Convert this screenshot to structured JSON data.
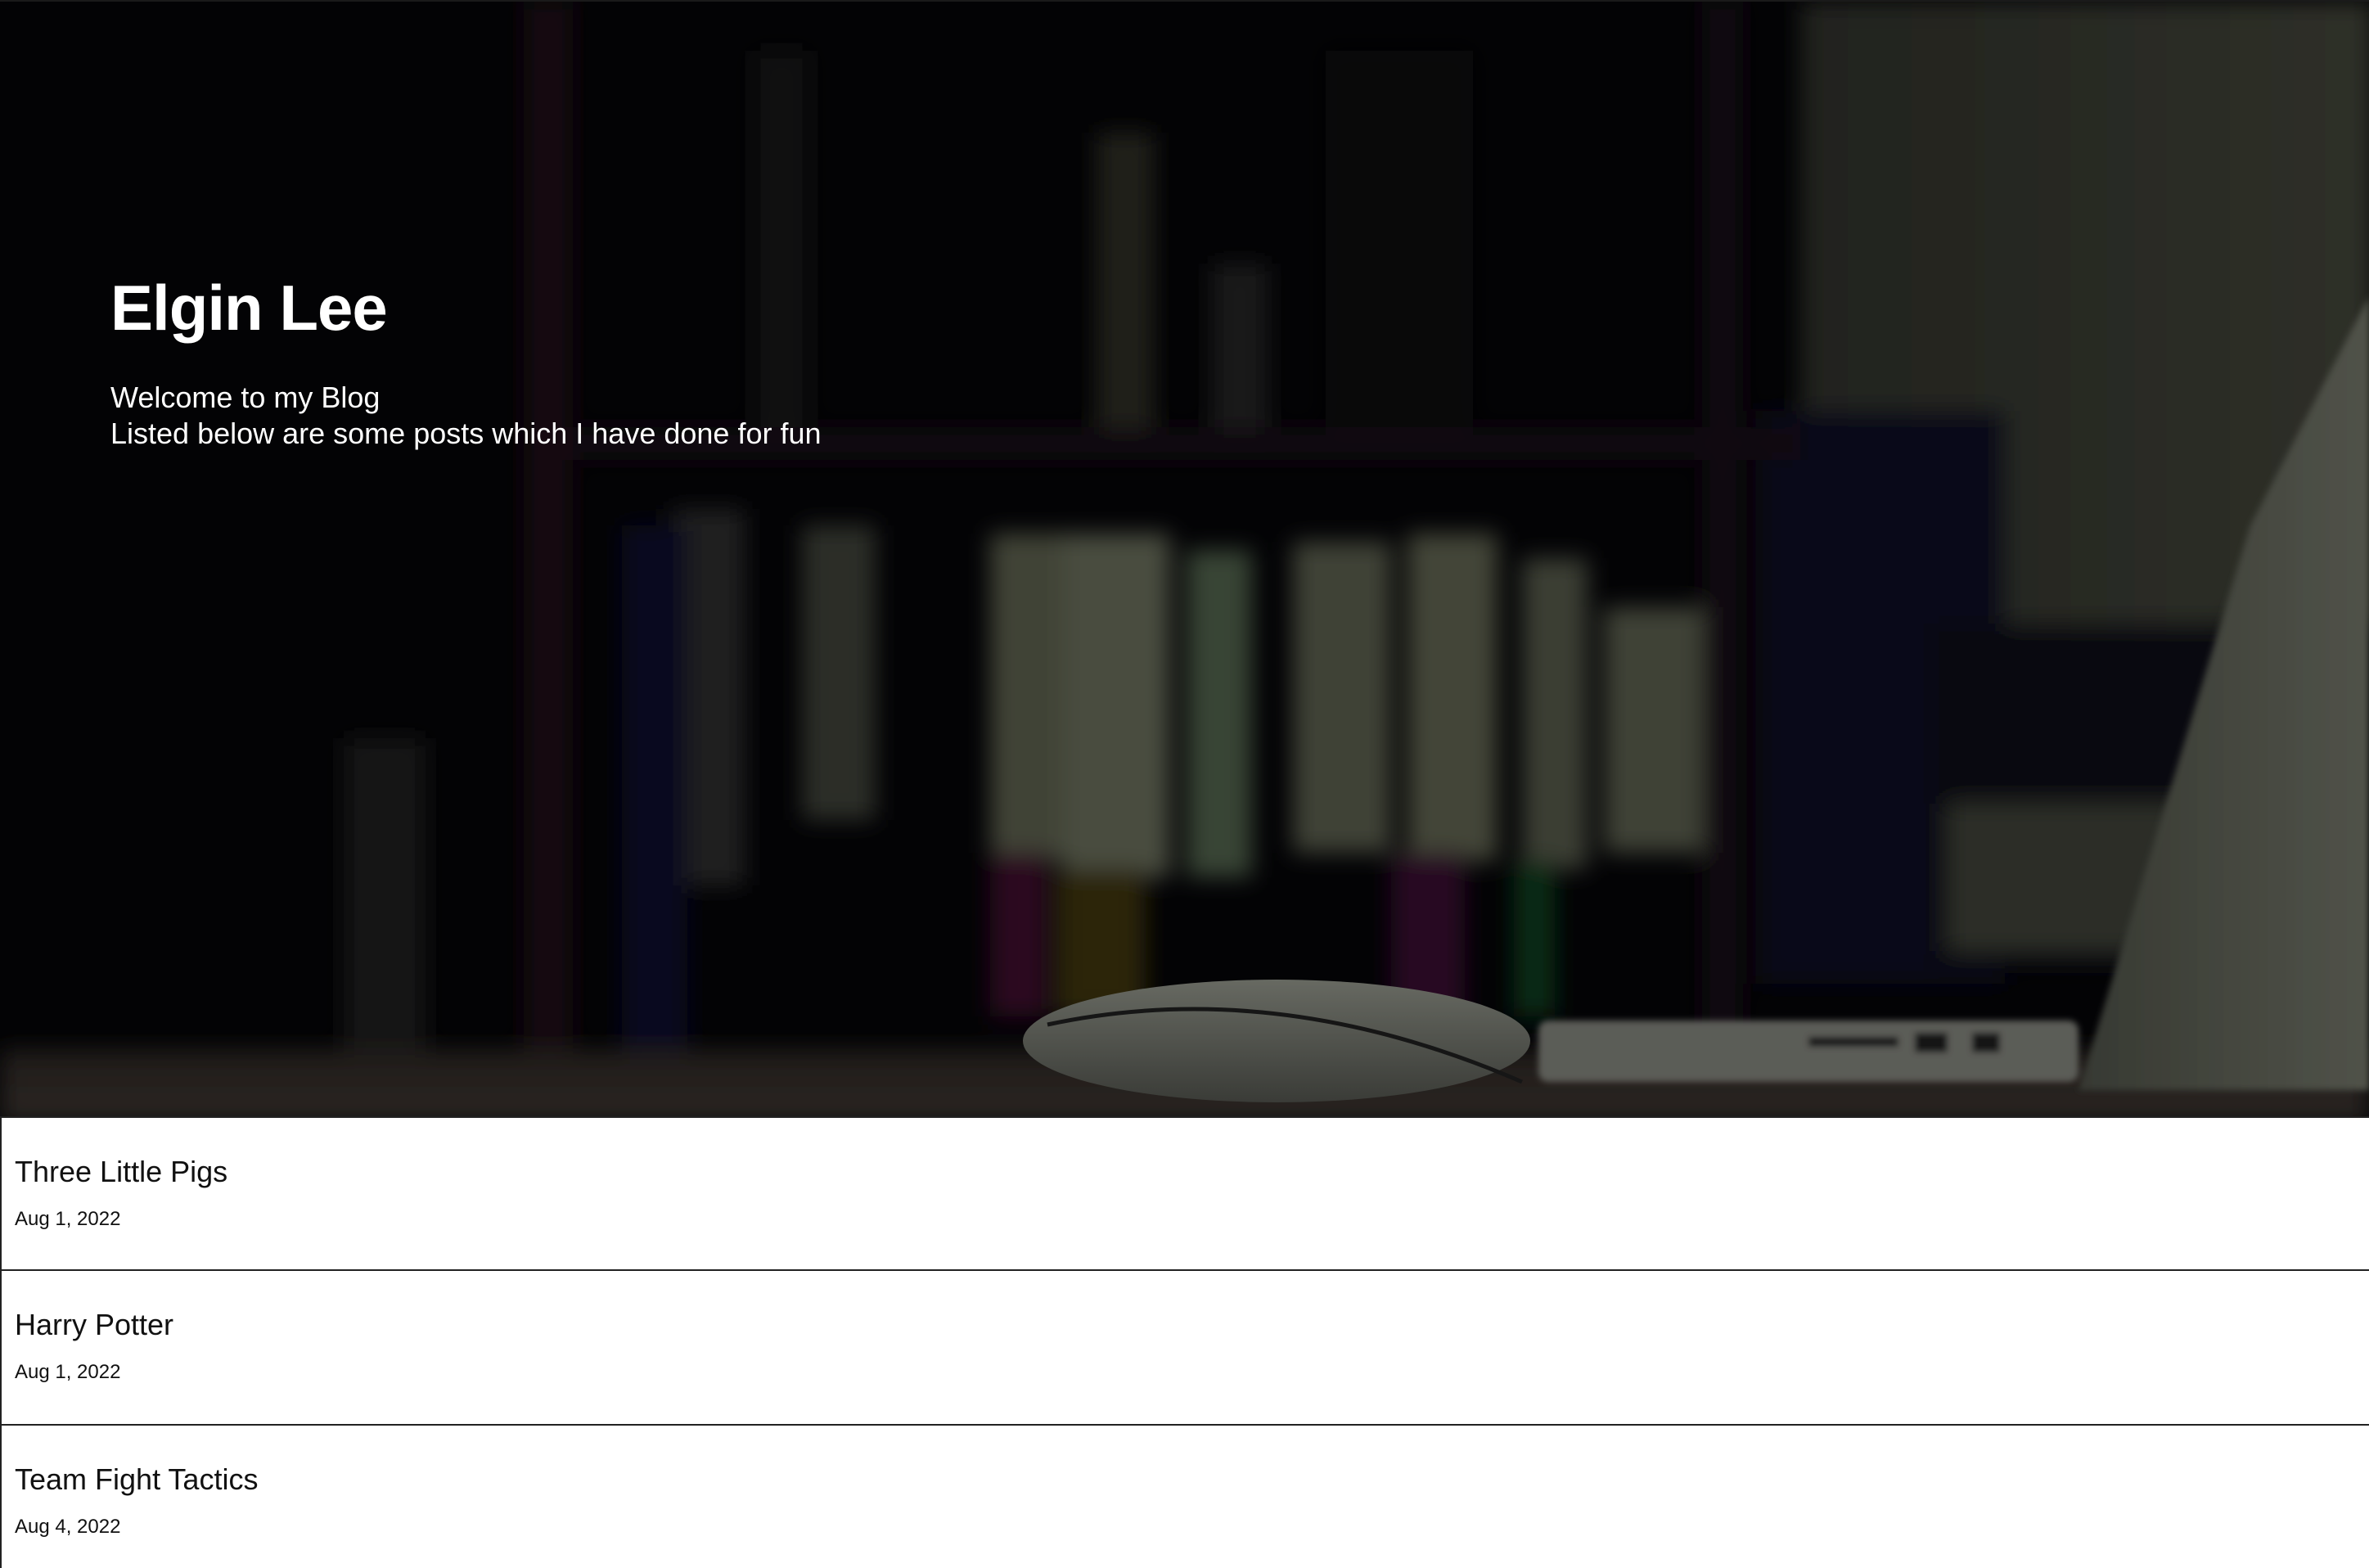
{
  "hero": {
    "title": "Elgin Lee",
    "subtitle_line1": "Welcome to my Blog",
    "subtitle_line2": "Listed below are some posts which I have done for fun"
  },
  "posts": [
    {
      "title": "Three Little Pigs",
      "date": "Aug 1, 2022"
    },
    {
      "title": "Harry Potter",
      "date": "Aug 1, 2022"
    },
    {
      "title": "Team Fight Tactics",
      "date": "Aug 4, 2022"
    }
  ]
}
